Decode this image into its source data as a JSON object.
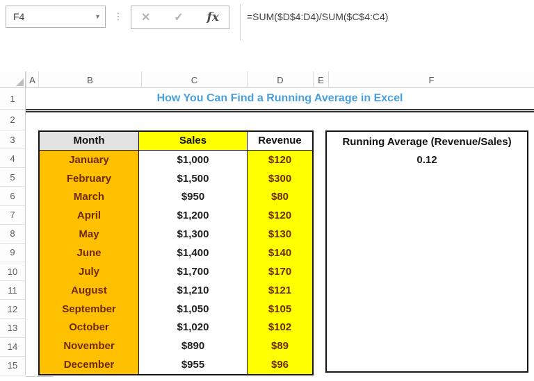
{
  "formula_bar": {
    "cell_reference": "F4",
    "formula": "=SUM($D$4:D4)/SUM($C$4:C4)",
    "cancel_icon": "✕",
    "enter_icon": "✓",
    "fx_icon": "fx",
    "dropdown_icon": "▾",
    "separator_icon": "⋮"
  },
  "grid": {
    "column_headers": [
      "A",
      "B",
      "C",
      "D",
      "E",
      "F"
    ],
    "row_headers": [
      "1",
      "2",
      "3",
      "4",
      "5",
      "6",
      "7",
      "8",
      "9",
      "10",
      "11",
      "12",
      "13",
      "14",
      "15"
    ],
    "title": "How You Can Find a Running Average in Excel"
  },
  "table": {
    "headers": [
      "Month",
      "Sales",
      "Revenue"
    ],
    "rows": [
      [
        "January",
        "$1,000",
        "$120"
      ],
      [
        "February",
        "$1,500",
        "$300"
      ],
      [
        "March",
        "$950",
        "$80"
      ],
      [
        "April",
        "$1,200",
        "$120"
      ],
      [
        "May",
        "$1,300",
        "$130"
      ],
      [
        "June",
        "$1,400",
        "$140"
      ],
      [
        "July",
        "$1,700",
        "$170"
      ],
      [
        "August",
        "$1,210",
        "$121"
      ],
      [
        "September",
        "$1,050",
        "$105"
      ],
      [
        "October",
        "$1,020",
        "$102"
      ],
      [
        "November",
        "$890",
        "$89"
      ],
      [
        "December",
        "$955",
        "$96"
      ]
    ]
  },
  "summary_box": {
    "label": "Running Average (Revenue/Sales)",
    "value": "0.12"
  },
  "colors": {
    "title_blue": "#4BA0DC",
    "month_header_fill": "#E3E3E3",
    "sales_header_fill": "#FFFF00",
    "revenue_header_fill": "#FFFFFF",
    "month_fill": "#FFC000",
    "sales_fill": "#FFFFFF",
    "revenue_fill": "#FFFF00",
    "dark_red_text": "#6E2A00",
    "sales_text": "#1f1f1f"
  }
}
